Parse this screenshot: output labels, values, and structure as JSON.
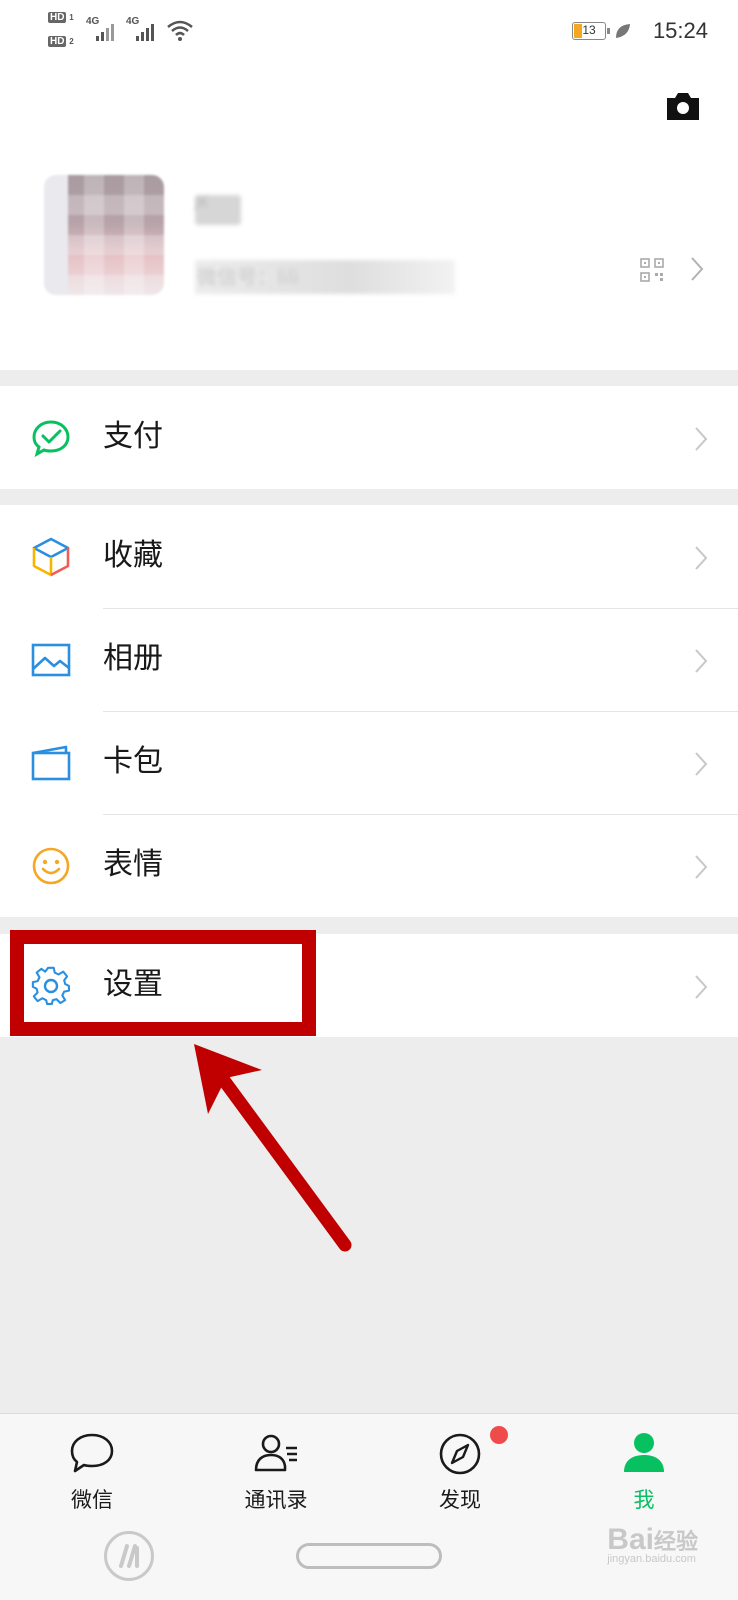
{
  "status_bar": {
    "hd1": "HD",
    "hd1_sim": "1",
    "hd2": "HD",
    "hd2_sim": "2",
    "net1": "4G",
    "net2": "4G",
    "battery": "13",
    "time": "15:24"
  },
  "profile": {
    "nickname": "JK",
    "wechat_id_label": "微信号：lili"
  },
  "menu": {
    "pay": "支付",
    "favorites": "收藏",
    "album": "相册",
    "cards": "卡包",
    "stickers": "表情",
    "settings": "设置"
  },
  "tabs": [
    {
      "label": "微信",
      "icon": "chat-bubble-icon"
    },
    {
      "label": "通讯录",
      "icon": "contacts-icon"
    },
    {
      "label": "发现",
      "icon": "compass-icon"
    },
    {
      "label": "我",
      "icon": "person-icon"
    }
  ],
  "watermark": {
    "brand": "Bai",
    "cn": "经验",
    "url": "jingyan.baidu.com"
  },
  "colors": {
    "accent_green": "#07c160",
    "highlight_red": "#c00000",
    "badge_red": "#f04b4b"
  }
}
